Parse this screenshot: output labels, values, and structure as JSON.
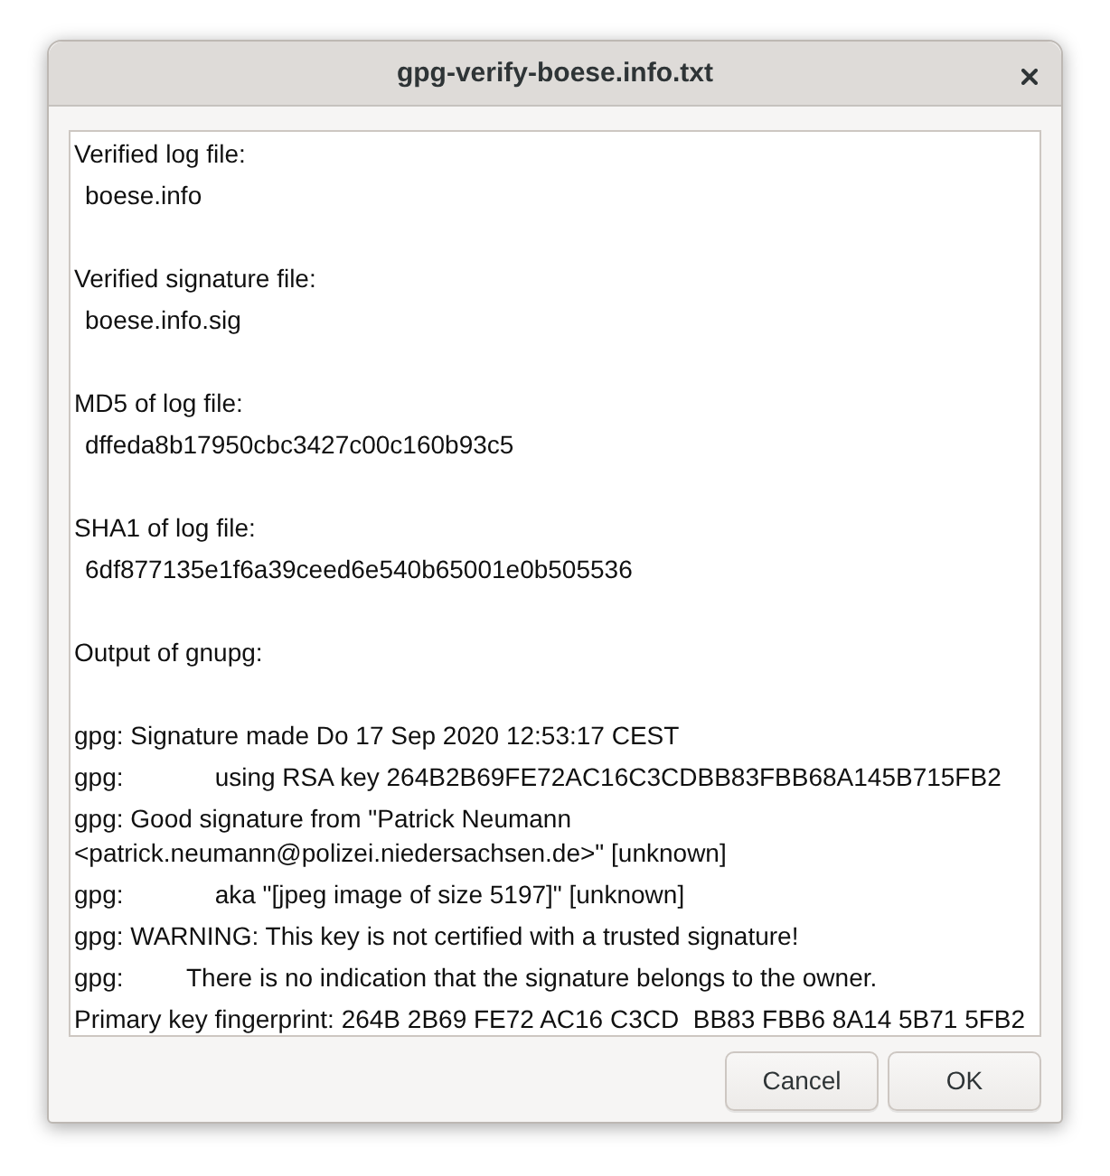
{
  "window": {
    "title": "gpg-verify-boese.info.txt"
  },
  "sections": [
    {
      "kind": "field",
      "heading": "Verified log file:",
      "lines": [
        "boese.info"
      ]
    },
    {
      "kind": "field",
      "heading": "Verified signature file:",
      "lines": [
        "boese.info.sig"
      ]
    },
    {
      "kind": "field",
      "heading": "MD5 of log file:",
      "lines": [
        "dffeda8b17950cbc3427c00c160b93c5"
      ]
    },
    {
      "kind": "field",
      "heading": "SHA1 of log file:",
      "lines": [
        "6df877135e1f6a39ceed6e540b65001e0b505536"
      ]
    },
    {
      "kind": "output",
      "heading": "Output of gnupg:",
      "lines": [
        "gpg: Signature made Do 17 Sep 2020 12:53:17 CEST",
        "gpg:             using RSA key 264B2B69FE72AC16C3CDBB83FBB68A145B715FB2",
        "gpg: Good signature from \"Patrick Neumann <patrick.neumann@polizei.niedersachsen.de>\" [unknown]",
        "gpg:             aka \"[jpeg image of size 5197]\" [unknown]",
        "gpg: WARNING: This key is not certified with a trusted signature!",
        "gpg:         There is no indication that the signature belongs to the owner.",
        "Primary key fingerprint: 264B 2B69 FE72 AC16 C3CD  BB83 FBB6 8A14 5B71 5FB2"
      ]
    }
  ],
  "buttons": [
    "Cancel",
    "OK"
  ]
}
